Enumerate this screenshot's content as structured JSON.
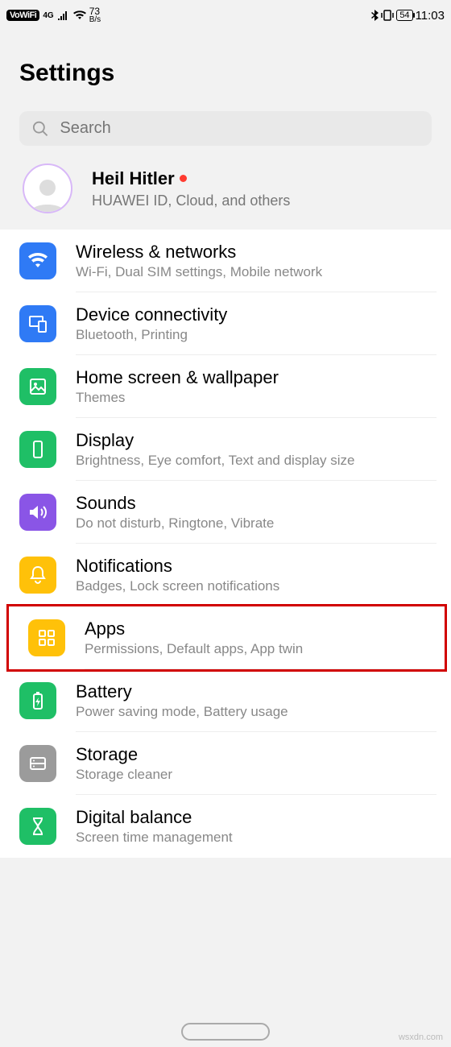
{
  "statusbar": {
    "vowifi": "VoWiFi",
    "net": "4G",
    "speed_num": "73",
    "speed_unit": "B/s",
    "battery": "54",
    "time": "11:03"
  },
  "title": "Settings",
  "search": {
    "placeholder": "Search"
  },
  "account": {
    "name": "Heil Hitler",
    "sub": "HUAWEI ID, Cloud, and others"
  },
  "items": [
    {
      "id": "wireless",
      "title": "Wireless & networks",
      "sub": "Wi-Fi, Dual SIM settings, Mobile network",
      "icon": "wifi-icon",
      "bg": "bg-blue"
    },
    {
      "id": "device",
      "title": "Device connectivity",
      "sub": "Bluetooth, Printing",
      "icon": "device-icon",
      "bg": "bg-blue"
    },
    {
      "id": "home",
      "title": "Home screen & wallpaper",
      "sub": "Themes",
      "icon": "wallpaper-icon",
      "bg": "bg-green"
    },
    {
      "id": "display",
      "title": "Display",
      "sub": "Brightness, Eye comfort, Text and display size",
      "icon": "display-icon",
      "bg": "bg-green"
    },
    {
      "id": "sounds",
      "title": "Sounds",
      "sub": "Do not disturb, Ringtone, Vibrate",
      "icon": "sound-icon",
      "bg": "bg-purple"
    },
    {
      "id": "notifications",
      "title": "Notifications",
      "sub": "Badges, Lock screen notifications",
      "icon": "bell-icon",
      "bg": "bg-yellow"
    },
    {
      "id": "apps",
      "title": "Apps",
      "sub": "Permissions, Default apps, App twin",
      "icon": "apps-icon",
      "bg": "bg-yellow",
      "highlight": true
    },
    {
      "id": "battery",
      "title": "Battery",
      "sub": "Power saving mode, Battery usage",
      "icon": "battery-icon",
      "bg": "bg-green"
    },
    {
      "id": "storage",
      "title": "Storage",
      "sub": "Storage cleaner",
      "icon": "storage-icon",
      "bg": "bg-grey"
    },
    {
      "id": "digital",
      "title": "Digital balance",
      "sub": "Screen time management",
      "icon": "hourglass-icon",
      "bg": "bg-green"
    }
  ],
  "watermark": "wsxdn.com"
}
